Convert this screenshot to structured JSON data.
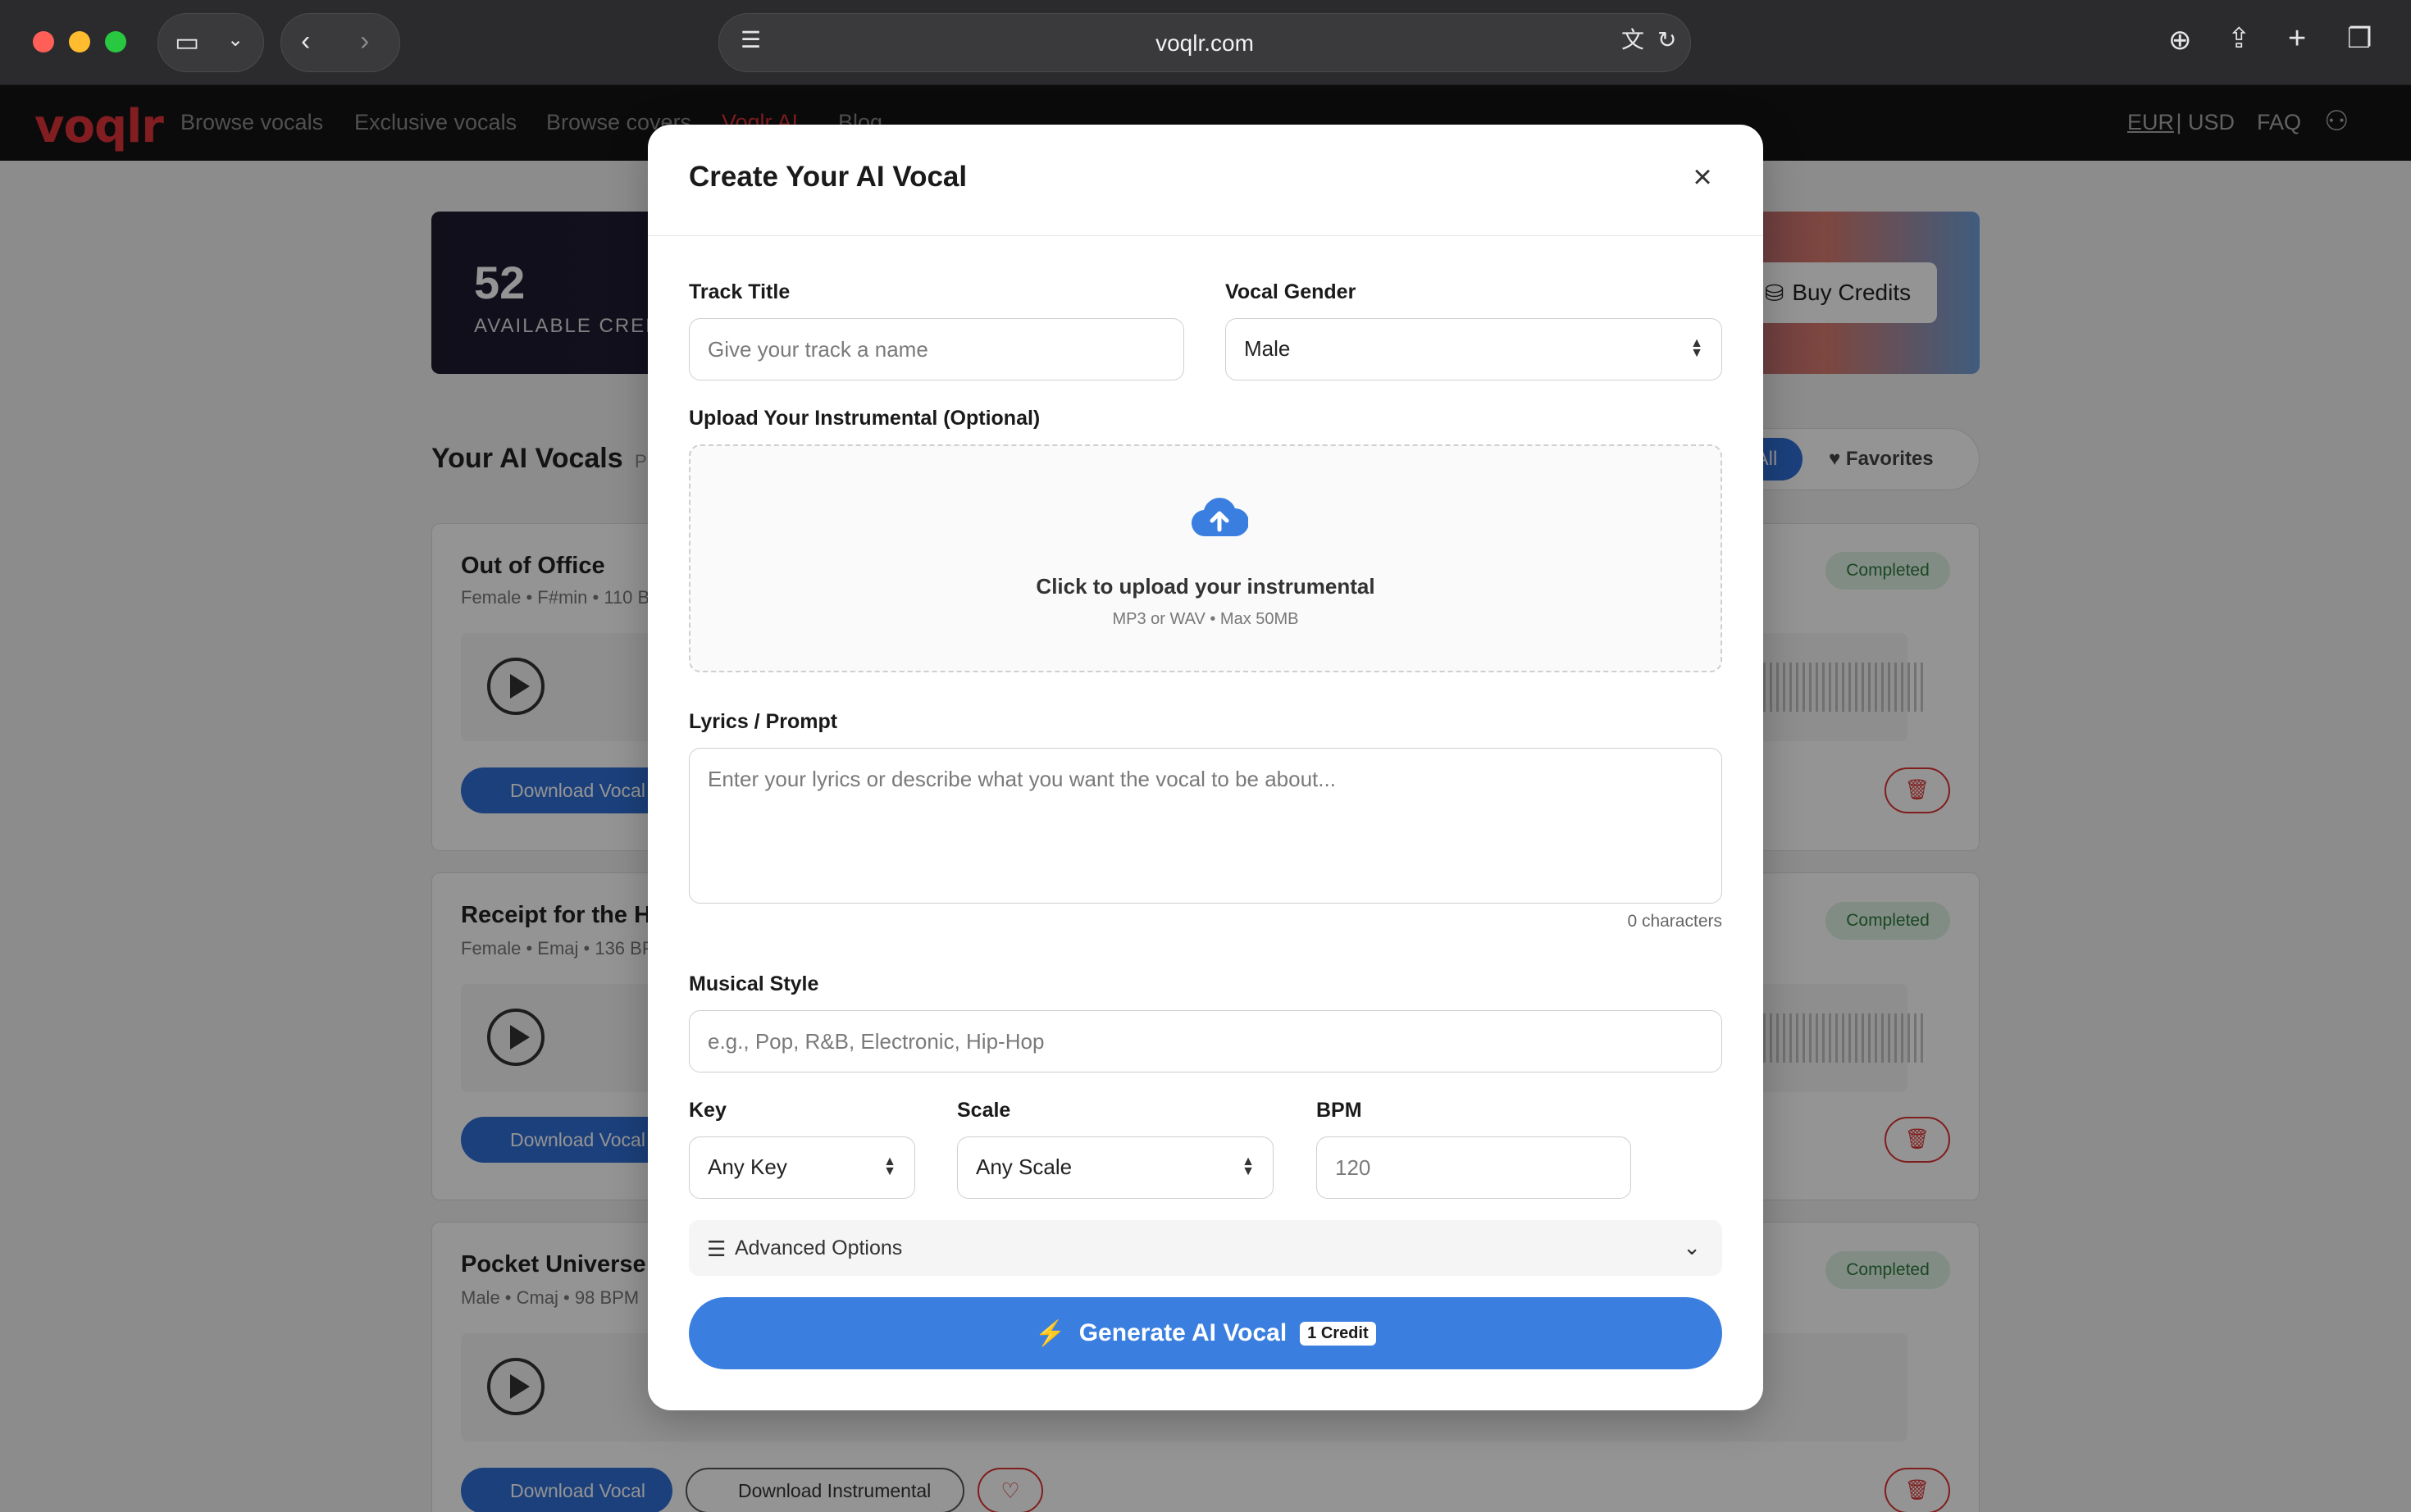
{
  "browser": {
    "url": "voqlr.com"
  },
  "site": {
    "logo": "voqlr",
    "nav": [
      {
        "label": "Browse vocals"
      },
      {
        "label": "Exclusive vocals"
      },
      {
        "label": "Browse covers"
      },
      {
        "label": "Voqlr AI"
      },
      {
        "label": "Blog"
      }
    ],
    "currency_eur": "EUR",
    "currency_sep": " | ",
    "currency_usd": "USD",
    "faq": "FAQ"
  },
  "credits": {
    "count": "52",
    "label": "AVAILABLE CREDITS",
    "buy_label": "Buy Credits"
  },
  "vocals": {
    "title": "Your AI Vocals",
    "subtitle": "P",
    "filter_all": "All",
    "filter_favorites": "Favorites",
    "items": [
      {
        "title": "Out of Office",
        "meta": "Female • F#min • 110 BPM",
        "status": "Completed"
      },
      {
        "title": "Receipt for the Heart",
        "meta": "Female • Emaj • 136 BPM",
        "status": "Completed"
      },
      {
        "title": "Pocket Universe",
        "meta": "Male • Cmaj • 98 BPM",
        "status": "Completed"
      }
    ],
    "download_vocal": "Download Vocal",
    "download_instrumental": "Download Instrumental"
  },
  "modal": {
    "title": "Create Your AI Vocal",
    "track_title_label": "Track Title",
    "track_title_placeholder": "Give your track a name",
    "vocal_gender_label": "Vocal Gender",
    "vocal_gender_value": "Male",
    "upload_label": "Upload Your Instrumental (Optional)",
    "upload_title": "Click to upload your instrumental",
    "upload_sub": "MP3 or WAV • Max 50MB",
    "lyrics_label": "Lyrics / Prompt",
    "lyrics_placeholder": "Enter your lyrics or describe what you want the vocal to be about...",
    "char_count": "0 characters",
    "style_label": "Musical Style",
    "style_placeholder": "e.g., Pop, R&B, Electronic, Hip-Hop",
    "key_label": "Key",
    "key_value": "Any Key",
    "scale_label": "Scale",
    "scale_value": "Any Scale",
    "bpm_label": "BPM",
    "bpm_placeholder": "120",
    "advanced_label": "Advanced Options",
    "generate_label": "Generate AI Vocal",
    "generate_badge": "1 Credit"
  },
  "colors": {
    "accent": "#3a7fe0",
    "brand": "#e0333a",
    "completed_bg": "#dff2e3",
    "completed_text": "#2d7a3e"
  }
}
